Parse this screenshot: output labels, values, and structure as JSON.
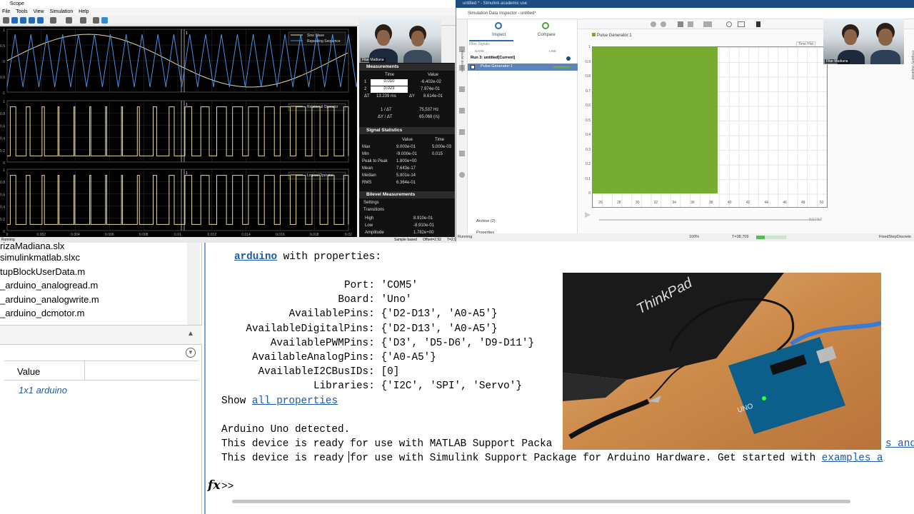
{
  "scope": {
    "title": "Scope",
    "menu": [
      "File",
      "Tools",
      "View",
      "Simulation",
      "Help"
    ],
    "plots": [
      {
        "legend": [
          "Sine Wave",
          "Repeating Sequence"
        ]
      },
      {
        "legend": [
          "Relational Operator"
        ]
      },
      {
        "legend": [
          "Logical Operator"
        ]
      }
    ],
    "y_ticks_top": [
      "1",
      "0.5",
      "0",
      "-0.5",
      "-1"
    ],
    "y_ticks_bin": [
      "1",
      "0.8",
      "0.6",
      "0.4",
      "0.2",
      "0"
    ],
    "x_ticks": [
      "0",
      "0.002",
      "0.004",
      "0.006",
      "0.008",
      "0.01",
      "0.012",
      "0.014",
      "0.016",
      "0.018",
      "0.02"
    ],
    "status_left": "Running",
    "status_mid": "Sample based",
    "status_offset": "Offset=2.92",
    "status_t": "T=2.9",
    "cursor_labels": [
      "1",
      "2"
    ]
  },
  "measurements": {
    "header": "Measurements",
    "col_time": "Time",
    "col_value": "Value",
    "rows": [
      {
        "idx": "1",
        "time": "0.010",
        "value": "-6.402e-02"
      },
      {
        "idx": "2",
        "time": "0.023",
        "value": "7.974e-01"
      }
    ],
    "dt_label": "ΔT",
    "dt": "13.239 ms",
    "dy_label": "ΔY",
    "dy": "8.614e-01",
    "inv_dt_label": "1 / ΔT",
    "inv_dt": "75.537 Hz",
    "dy_dt_label": "ΔY / ΔT",
    "dy_dt": "65.068 (/s)"
  },
  "signal_stats": {
    "header": "Signal Statistics",
    "col_value": "Value",
    "col_time": "Time",
    "rows": [
      {
        "name": "Max",
        "value": "9.000e-01",
        "time": "5.000e-03"
      },
      {
        "name": "Min",
        "value": "-9.000e-01",
        "time": "0.015"
      },
      {
        "name": "Peak to Peak",
        "value": "1.800e+00",
        "time": ""
      },
      {
        "name": "Mean",
        "value": "7.643e-17",
        "time": ""
      },
      {
        "name": "Median",
        "value": "5.801e-14",
        "time": ""
      },
      {
        "name": "RMS",
        "value": "6.364e-01",
        "time": ""
      }
    ]
  },
  "bilevel": {
    "header": "Bilevel Measurements",
    "settings": "Settings",
    "transitions": "Transitions",
    "rows": [
      {
        "name": "High",
        "value": "8.910e-01"
      },
      {
        "name": "Low",
        "value": "-8.910e-01"
      },
      {
        "name": "Amplitude",
        "value": "1.782e+00"
      }
    ]
  },
  "webcam_left": {
    "label": "Fitar Madiana"
  },
  "webcam_right": {
    "label": "Fitar Madiana"
  },
  "sdi": {
    "title": "Simulation Data Inspector - untitled*",
    "parent_title": "untitled * - Simulink academic use",
    "tab_inspect": "Inspect",
    "tab_compare": "Compare",
    "filter": "Filter Signals",
    "col_name": "NAME",
    "col_line": "LINE",
    "run_label": "Run 3: untitled[Current]",
    "signal": "Pulse Generator:1",
    "plot_legend": "Pulse Generator:1",
    "time_plot": "Time Plot",
    "archive": "Archive (2)",
    "properties": "Properties",
    "y_ticks": [
      "1",
      "0.9",
      "0.8",
      "0.7",
      "0.6",
      "0.5",
      "0.4",
      "0.3",
      "0.2",
      "0.1",
      "0"
    ],
    "x_ticks": [
      "26",
      "28",
      "30",
      "32",
      "34",
      "36",
      "38",
      "40",
      "42",
      "44",
      "46",
      "48",
      "50"
    ],
    "time_readout": "0.0 / 0.0",
    "status_left": "Running",
    "zoom": "100%",
    "time": "T=38.709",
    "solver": "FixedStepDiscrete",
    "side_tab": "Property Inspector",
    "side_tab_left": "Model Browser",
    "color": "#77ac33"
  },
  "files": [
    "rizaMadiana.slx",
    "simulinkmatlab.slxc",
    "tupBlockUserData.m",
    "_arduino_analogread.m",
    "_arduino_analogwrite.m",
    "_arduino_dcmotor.m"
  ],
  "workspace": {
    "col_value": "Value",
    "value": "1x1 arduino"
  },
  "command": {
    "header_var": "arduino",
    "header_rest": " with properties:",
    "props": [
      {
        "name": "Port",
        "value": "'COM5'"
      },
      {
        "name": "Board",
        "value": "'Uno'"
      },
      {
        "name": "AvailablePins",
        "value": "{'D2-D13', 'A0-A5'}"
      },
      {
        "name": "AvailableDigitalPins",
        "value": "{'D2-D13', 'A0-A5'}"
      },
      {
        "name": "AvailablePWMPins",
        "value": "{'D3', 'D5-D6', 'D9-D11'}"
      },
      {
        "name": "AvailableAnalogPins",
        "value": "{'A0-A5'}"
      },
      {
        "name": "AvailableI2CBusIDs",
        "value": "[0]"
      },
      {
        "name": "Libraries",
        "value": "{'I2C', 'SPI', 'Servo'}"
      }
    ],
    "show": "Show ",
    "all_props": "all properties",
    "detected": "Arduino Uno detected.",
    "ready1": "This device is ready for use with MATLAB Support Packa",
    "ready1_link": "s and",
    "ready2": "This device is ready for use with Simulink Support Package for Arduino Hardware. Get started with ",
    "ready2_link": "examples a",
    "prompt": ">>",
    "fx": "fx"
  },
  "photo": {
    "laptop_brand": "ThinkPad",
    "board_text": "UNO"
  }
}
